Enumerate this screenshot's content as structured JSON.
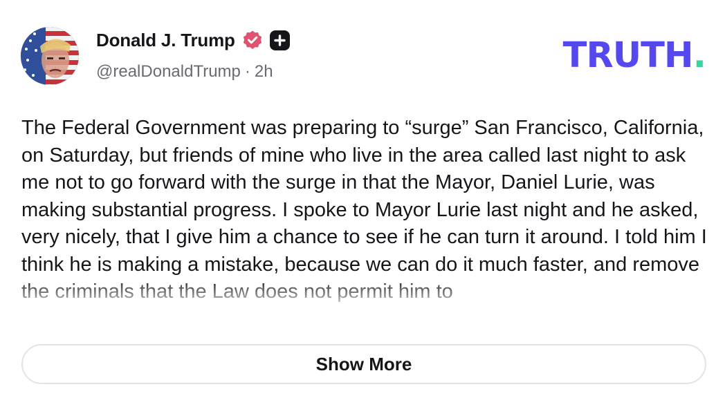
{
  "post": {
    "author_name": "Donald J. Trump",
    "handle": "@realDonaldTrump",
    "separator": "·",
    "time_ago": "2h",
    "body": "The Federal Government was preparing to “surge” San Francisco, California, on Saturday, but friends of mine who live in the area called last night to ask me not to go forward with the surge in that the Mayor, Daniel Lurie, was making substantial progress. I spoke to Mayor Lurie last night and he asked, very nicely, that I give him a chance to see if he can turn it around. I told him I think he is making a mistake, because we can do it much faster, and remove the criminals that the Law does not permit him to",
    "show_more_label": "Show More"
  },
  "brand": {
    "logo_text": "TRUTH",
    "logo_dot": "."
  },
  "icons": {
    "verified": "verified-badge-icon",
    "plus": "plus-badge-icon",
    "avatar": "profile-avatar"
  },
  "colors": {
    "brand_purple": "#5448ee",
    "brand_green": "#35d4a0",
    "verified_pink": "#e0526f",
    "text_primary": "#15151a",
    "text_secondary": "#6a6a72",
    "border": "#e3e3e8"
  }
}
